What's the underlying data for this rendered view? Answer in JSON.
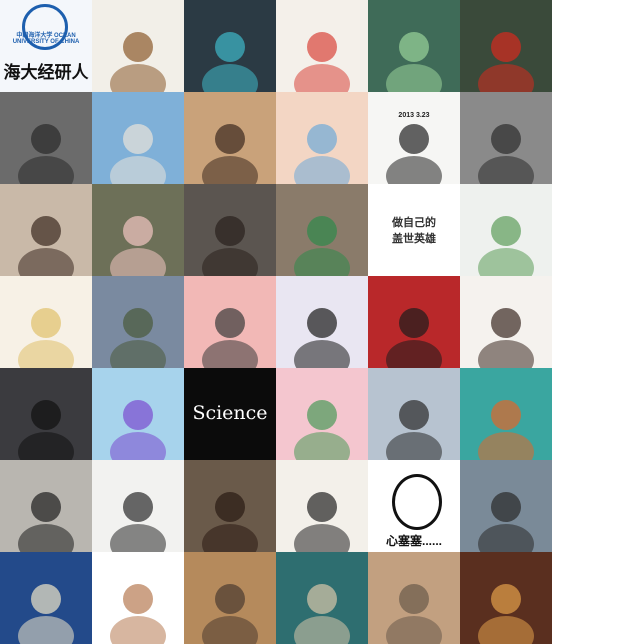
{
  "grid": {
    "columns": 6,
    "rows": 7,
    "avatars": [
      {
        "label": "ocean-university-logo",
        "caption": "海大经研人",
        "subcaption": "中国海洋大学 OCEAN UNIVERSITY OF CHINA",
        "bg": "#f4f7fb",
        "accent": "#1d5fae"
      },
      {
        "label": "cartoon-boy",
        "caption": "",
        "bg": "#f2efe8",
        "accent": "#8b5a2b"
      },
      {
        "label": "singer-blue-hair",
        "caption": "",
        "bg": "#2b3a44",
        "accent": "#3fb8c9"
      },
      {
        "label": "sketch-scooter",
        "caption": "",
        "bg": "#f4f0ea",
        "accent": "#d9453b"
      },
      {
        "label": "dandelion-field",
        "caption": "",
        "bg": "#3f6b58",
        "accent": "#9ad39a"
      },
      {
        "label": "red-maple-leaf",
        "caption": "",
        "bg": "#3a4a3a",
        "accent": "#d62a1e"
      },
      {
        "label": "man-on-rocks",
        "caption": "",
        "bg": "#6b6b6b",
        "accent": "#2a2a2a"
      },
      {
        "label": "girl-at-sea",
        "caption": "",
        "bg": "#7fb0d8",
        "accent": "#e9e4da"
      },
      {
        "label": "girl-sitting-beach",
        "caption": "",
        "bg": "#c9a27a",
        "accent": "#3c2a1f"
      },
      {
        "label": "cartoon-boy-heart",
        "caption": "",
        "bg": "#f3d6c4",
        "accent": "#6ea9d8"
      },
      {
        "label": "panda-date",
        "caption": "",
        "subcaption": "2013 3.23",
        "bg": "#f6f6f4",
        "accent": "#222222"
      },
      {
        "label": "man-on-sofa",
        "caption": "",
        "bg": "#8a8a8a",
        "accent": "#2c2c2c"
      },
      {
        "label": "baby-face",
        "caption": "",
        "bg": "#c9b9a8",
        "accent": "#3a2a20"
      },
      {
        "label": "cartoon-pig",
        "caption": "",
        "bg": "#6d7058",
        "accent": "#f2c6c2"
      },
      {
        "label": "woman-portrait",
        "caption": "",
        "bg": "#5b5550",
        "accent": "#2a211c"
      },
      {
        "label": "cat-biting",
        "caption": "",
        "bg": "#8a7b6a",
        "accent": "#2f8a4b"
      },
      {
        "label": "text-doodle",
        "caption": "做自己的",
        "subcaption": "盖世英雄",
        "bg": "#ffffff",
        "accent": "#e8b640"
      },
      {
        "label": "green-plant",
        "caption": "",
        "bg": "#eef1ee",
        "accent": "#5c9c5a"
      },
      {
        "label": "anime-blond-boy",
        "caption": "",
        "bg": "#f7f1e6",
        "accent": "#e0c06a"
      },
      {
        "label": "girl-in-room",
        "caption": "",
        "bg": "#7a8aa0",
        "accent": "#4a5a3a"
      },
      {
        "label": "cartoon-headband",
        "caption": "",
        "bg": "#f2b8b6",
        "accent": "#3a3a3a"
      },
      {
        "label": "selfie-girl",
        "caption": "",
        "bg": "#e9e6f2",
        "accent": "#1a1a1a"
      },
      {
        "label": "anime-boy-red",
        "caption": "",
        "bg": "#b9282a",
        "accent": "#1c1c1c"
      },
      {
        "label": "chibi-boy-coffee",
        "caption": "",
        "bg": "#f5f2ee",
        "accent": "#3a2a22"
      },
      {
        "label": "kid-sunglasses",
        "caption": "",
        "bg": "#3b3b3f",
        "accent": "#111111"
      },
      {
        "label": "crayon-shin-glasses",
        "caption": "",
        "bg": "#a7d3ec",
        "accent": "#7a4bd0"
      },
      {
        "label": "science-text",
        "caption": "Science",
        "bg": "#0b0b0b",
        "accent": "#ffffff"
      },
      {
        "label": "anime-pink-hair",
        "caption": "",
        "bg": "#f4c6cf",
        "accent": "#4a9a58"
      },
      {
        "label": "girl-by-sea",
        "caption": "",
        "bg": "#b7c3d0",
        "accent": "#2a2a2a"
      },
      {
        "label": "basketball-cartoon",
        "caption": "",
        "bg": "#3aa6a0",
        "accent": "#e0662a"
      },
      {
        "label": "hiker-silhouette",
        "caption": "",
        "bg": "#b9b6b0",
        "accent": "#1e1e1e"
      },
      {
        "label": "praying-man-sketch",
        "caption": "",
        "bg": "#f2f2f0",
        "accent": "#2a2a2a"
      },
      {
        "label": "boy-face",
        "caption": "",
        "bg": "#6a5a4a",
        "accent": "#2a1a12"
      },
      {
        "label": "cartoon-boy-hoodie",
        "caption": "",
        "bg": "#f3f0ea",
        "accent": "#222222"
      },
      {
        "label": "crying-meme",
        "caption": "心塞塞......",
        "bg": "#ffffff",
        "accent": "#111111"
      },
      {
        "label": "man-street",
        "caption": "",
        "bg": "#7a8a98",
        "accent": "#2a2a2a"
      },
      {
        "label": "night-sky",
        "caption": "",
        "bg": "#234a8a",
        "accent": "#f0e6c8"
      },
      {
        "label": "jerry-mouse",
        "caption": "",
        "bg": "#ffffff",
        "accent": "#b77a52"
      },
      {
        "label": "mountain-sunset",
        "caption": "",
        "bg": "#b58a5c",
        "accent": "#4a3a30"
      },
      {
        "label": "rabbit-drawing",
        "caption": "",
        "bg": "#2e6e70",
        "accent": "#d9c6aa"
      },
      {
        "label": "cat-resting",
        "caption": "",
        "bg": "#c2a080",
        "accent": "#6a5a4a"
      },
      {
        "label": "great-hall",
        "caption": "",
        "bg": "#5a2f1f",
        "accent": "#e3a04a"
      }
    ]
  }
}
